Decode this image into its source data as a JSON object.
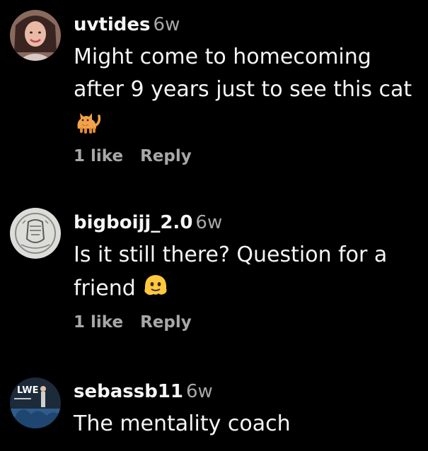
{
  "comments": [
    {
      "username": "uvtides",
      "time": "6w",
      "text": "Might come to homecoming after 9 years just to see this cat",
      "emoji_icon": "cat-icon",
      "likes": "1 like",
      "reply": "Reply"
    },
    {
      "username": "bigboijj_2.0",
      "time": "6w",
      "text": "Is it still there? Question for a friend",
      "emoji_icon": "melting-face-icon",
      "likes": "1 like",
      "reply": "Reply"
    },
    {
      "username": "sebassb11",
      "time": "6w",
      "text": "The mentality coach"
    }
  ],
  "avatar_logo_text": "LWE",
  "colors": {
    "background": "#000000",
    "primary_text": "#f5f5f5",
    "secondary_text": "#a8a8a8"
  }
}
